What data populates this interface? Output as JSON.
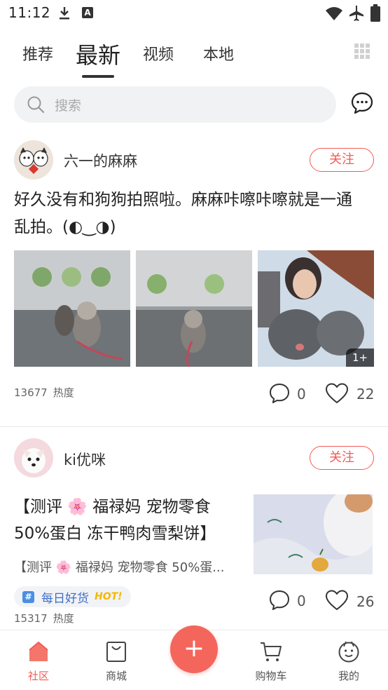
{
  "status_bar": {
    "time": "11:12",
    "a_badge": "A"
  },
  "tabs": [
    {
      "label": "推荐"
    },
    {
      "label": "最新",
      "active": true
    },
    {
      "label": "视频"
    },
    {
      "label": "本地"
    }
  ],
  "search": {
    "placeholder": "搜索"
  },
  "posts": [
    {
      "author": "六一的麻麻",
      "follow_label": "关注",
      "text": "好久没有和狗狗拍照啦。麻麻咔嚓咔嚓就是一通乱拍。(◐‿◑)",
      "photos": [
        "dog-photo-1",
        "dog-photo-2",
        "dog-photo-3"
      ],
      "more_badge": "1+",
      "heat_value": "13677",
      "heat_label": "热度",
      "comments": "0",
      "likes": "22"
    },
    {
      "author": "ki优咪",
      "follow_label": "关注",
      "title": "【测评 🌸 福禄妈 宠物零食 50%蛋白 冻干鸭肉雪梨饼】",
      "subtitle": "【测评 🌸 福禄妈 宠物零食 50%蛋...",
      "tag_text": "每日好货",
      "tag_hot": "HOT!",
      "heat_value": "15317",
      "heat_label": "热度",
      "comments": "0",
      "likes": "26"
    }
  ],
  "bottom_nav": [
    {
      "label": "社区",
      "icon": "home-icon",
      "active": true
    },
    {
      "label": "商城",
      "icon": "shop-bag-icon"
    },
    {
      "label": "购物车",
      "icon": "cart-icon"
    },
    {
      "label": "我的",
      "icon": "profile-face-icon"
    }
  ],
  "fab": {
    "symbol": "+"
  },
  "colors": {
    "accent": "#f35b54",
    "tag_blue": "#3d6fc8",
    "hot_yellow": "#f5b800"
  }
}
